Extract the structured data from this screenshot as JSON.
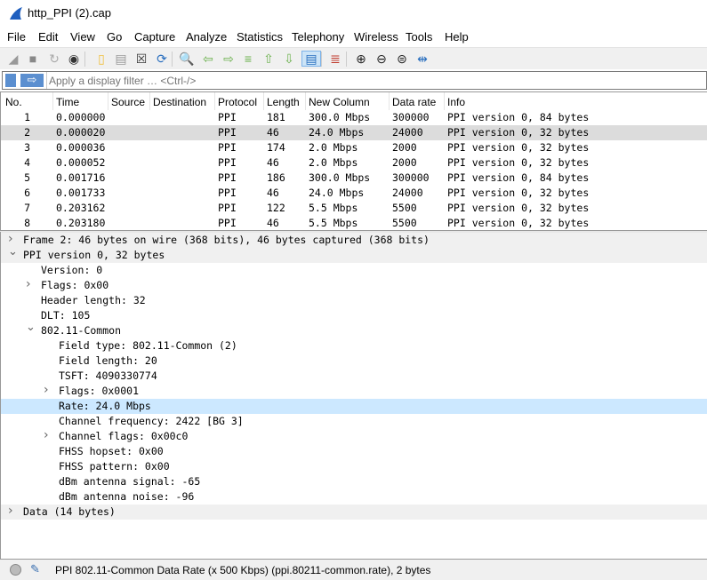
{
  "window": {
    "title": "http_PPI (2).cap"
  },
  "menu": [
    "File",
    "Edit",
    "View",
    "Go",
    "Capture",
    "Analyze",
    "Statistics",
    "Telephony",
    "Wireless",
    "Tools",
    "Help"
  ],
  "toolbar": [
    "shark-fin-start-icon",
    "stop-icon",
    "restart-icon",
    "options-gear-icon",
    "open-file-icon",
    "save-file-icon",
    "close-file-icon",
    "reload-icon",
    "find-icon",
    "go-back-icon",
    "go-forward-icon",
    "go-to-packet-icon",
    "first-packet-icon",
    "last-packet-icon",
    "autoscroll-icon",
    "colorize-icon",
    "zoom-in-icon",
    "zoom-out-icon",
    "normal-size-icon",
    "resize-columns-icon"
  ],
  "filter": {
    "placeholder": "Apply a display filter … <Ctrl-/>",
    "value": ""
  },
  "packet_list": {
    "columns": [
      "No.",
      "Time",
      "Source",
      "Destination",
      "Protocol",
      "Length",
      "New Column",
      "Data rate",
      "Info"
    ],
    "rows": [
      [
        "1",
        "0.000000",
        "",
        "",
        "PPI",
        "181",
        "300.0 Mbps",
        "300000",
        "PPI version 0, 84 bytes"
      ],
      [
        "2",
        "0.000020",
        "",
        "",
        "PPI",
        "46",
        "24.0 Mbps",
        "24000",
        "PPI version 0, 32 bytes"
      ],
      [
        "3",
        "0.000036",
        "",
        "",
        "PPI",
        "174",
        "2.0 Mbps",
        "2000",
        "PPI version 0, 32 bytes"
      ],
      [
        "4",
        "0.000052",
        "",
        "",
        "PPI",
        "46",
        "2.0 Mbps",
        "2000",
        "PPI version 0, 32 bytes"
      ],
      [
        "5",
        "0.001716",
        "",
        "",
        "PPI",
        "186",
        "300.0 Mbps",
        "300000",
        "PPI version 0, 84 bytes"
      ],
      [
        "6",
        "0.001733",
        "",
        "",
        "PPI",
        "46",
        "24.0 Mbps",
        "24000",
        "PPI version 0, 32 bytes"
      ],
      [
        "7",
        "0.203162",
        "",
        "",
        "PPI",
        "122",
        "5.5 Mbps",
        "5500",
        "PPI version 0, 32 bytes"
      ],
      [
        "8",
        "0.203180",
        "",
        "",
        "PPI",
        "46",
        "5.5 Mbps",
        "5500",
        "PPI version 0, 32 bytes"
      ]
    ],
    "selected_index": 1
  },
  "details": [
    {
      "level": 0,
      "arrow": "collapsed",
      "text": "Frame 2: 46 bytes on wire (368 bits), 46 bytes captured (368 bits)"
    },
    {
      "level": 0,
      "arrow": "expanded",
      "text": "PPI version 0, 32 bytes"
    },
    {
      "level": 1,
      "arrow": "",
      "text": "Version: 0"
    },
    {
      "level": 1,
      "arrow": "collapsed",
      "text": "Flags: 0x00"
    },
    {
      "level": 1,
      "arrow": "",
      "text": "Header length: 32"
    },
    {
      "level": 1,
      "arrow": "",
      "text": "DLT: 105"
    },
    {
      "level": 1,
      "arrow": "expanded",
      "text": "802.11-Common"
    },
    {
      "level": 2,
      "arrow": "",
      "text": "Field type: 802.11-Common (2)"
    },
    {
      "level": 2,
      "arrow": "",
      "text": "Field length: 20"
    },
    {
      "level": 2,
      "arrow": "",
      "text": "TSFT: 4090330774"
    },
    {
      "level": 2,
      "arrow": "collapsed",
      "text": "Flags: 0x0001"
    },
    {
      "level": 2,
      "arrow": "",
      "text": "Rate: 24.0 Mbps",
      "selected": true
    },
    {
      "level": 2,
      "arrow": "",
      "text": "Channel frequency: 2422 [BG 3]"
    },
    {
      "level": 2,
      "arrow": "collapsed",
      "text": "Channel flags: 0x00c0"
    },
    {
      "level": 2,
      "arrow": "",
      "text": "FHSS hopset: 0x00"
    },
    {
      "level": 2,
      "arrow": "",
      "text": "FHSS pattern: 0x00"
    },
    {
      "level": 2,
      "arrow": "",
      "text": "dBm antenna signal: -65"
    },
    {
      "level": 2,
      "arrow": "",
      "text": "dBm antenna noise: -96"
    },
    {
      "level": 0,
      "arrow": "collapsed",
      "text": "Data (14 bytes)"
    }
  ],
  "status": {
    "text": "PPI 802.11-Common Data Rate (x 500 Kbps) (ppi.80211-common.rate), 2 bytes"
  },
  "colors": {
    "selected_packet": "#dcdcdc",
    "selected_field": "#cce8ff",
    "accent": "#5b8fd0"
  }
}
